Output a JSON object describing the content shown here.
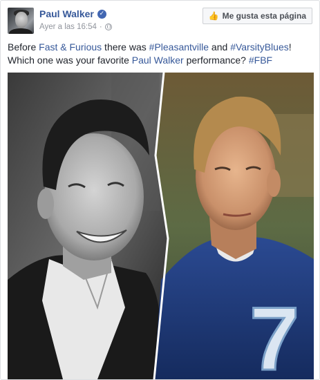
{
  "post": {
    "page_name": "Paul Walker",
    "verified_icon": "verified-badge-icon",
    "timestamp": "Ayer a las 16:54",
    "separator": "·",
    "privacy_icon": "globe-icon",
    "like_page_label": "Me gusta esta página",
    "like_icon": "thumbs-up-icon",
    "text": {
      "before": "Before ",
      "link1": "Fast & Furious",
      "mid1": " there was ",
      "tag1": "#Pleasantville",
      "mid2": " and ",
      "tag2": "#VarsityBlues",
      "mid3": "! Which one was your favorite ",
      "link2": "Paul Walker",
      "mid4": " performance? ",
      "tag3": "#FBF"
    },
    "photo": {
      "jersey_number": "7"
    }
  },
  "colors": {
    "link": "#365899",
    "text": "#1d2129",
    "meta": "#90949c",
    "jersey": "#1f3a7a"
  }
}
